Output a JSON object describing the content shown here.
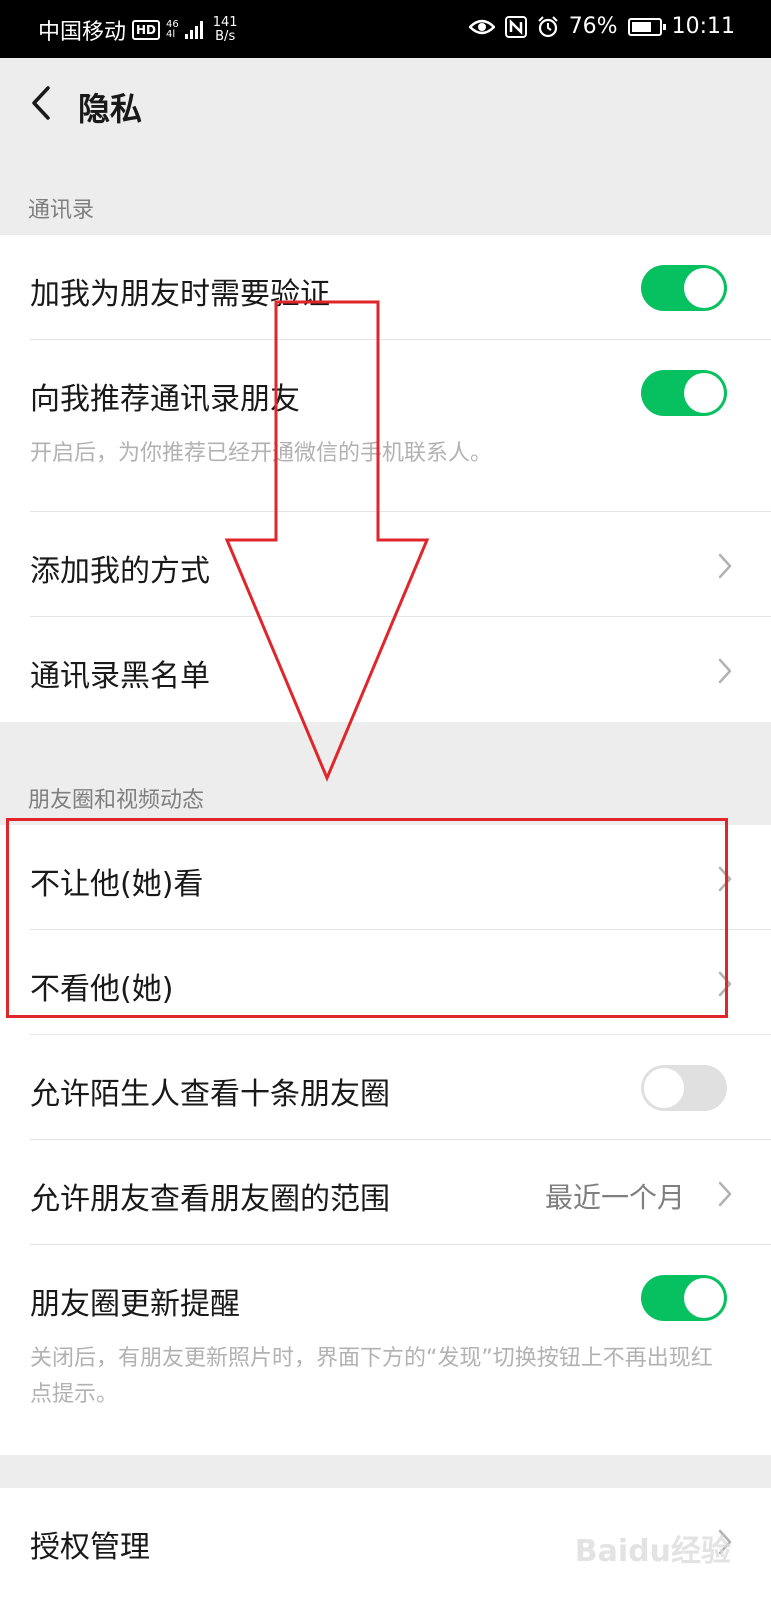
{
  "status_bar": {
    "carrier": "中国移动",
    "hd": "HD",
    "net_top": "46",
    "net_bottom": "4l",
    "speed_value": "141",
    "speed_unit": "B/s",
    "battery": "76%",
    "battery_level": 0.76,
    "time": "10:11"
  },
  "nav": {
    "title": "隐私"
  },
  "contacts_section": {
    "header": "通讯录",
    "rows": [
      {
        "label": "加我为朋友时需要验证",
        "toggle": true
      },
      {
        "label": "向我推荐通讯录朋友",
        "toggle": true,
        "desc": "开启后，为你推荐已经开通微信的手机联系人。"
      },
      {
        "label": "添加我的方式"
      },
      {
        "label": "通讯录黑名单"
      }
    ]
  },
  "moments_section": {
    "header": "朋友圈和视频动态",
    "rows": [
      {
        "label": "不让他(她)看"
      },
      {
        "label": "不看他(她)"
      },
      {
        "label": "允许陌生人查看十条朋友圈",
        "toggle": false
      },
      {
        "label": "允许朋友查看朋友圈的范围",
        "value": "最近一个月"
      },
      {
        "label": "朋友圈更新提醒",
        "toggle": true,
        "desc": "关闭后，有朋友更新照片时，界面下方的“发现”切换按钮上不再出现红点提示。"
      }
    ]
  },
  "auth_section": {
    "rows": [
      {
        "label": "授权管理"
      }
    ]
  },
  "watermark": "Baidu经验",
  "colors": {
    "accent_green": "#07c160",
    "annotation_red": "#e0262a",
    "background": "#ededed"
  }
}
